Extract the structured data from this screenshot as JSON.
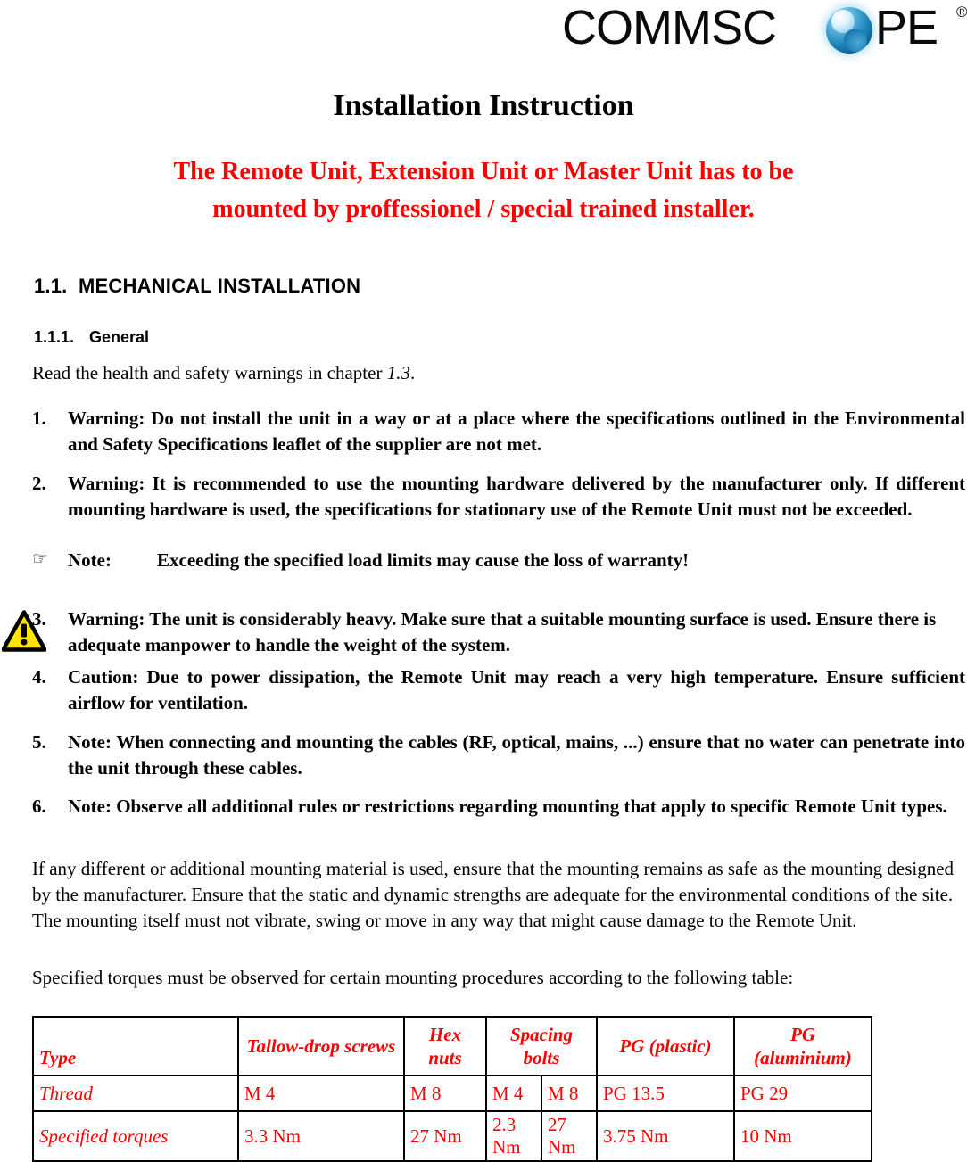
{
  "logo": {
    "text_part1": "COMMSC",
    "text_part2": "PE",
    "registered_mark": "®",
    "sphere_icon": "commscope-sphere-icon",
    "brand_blue": "#1f86bd"
  },
  "title": "Installation Instruction",
  "warning_banner": {
    "line1": "The Remote Unit, Extension Unit or Master Unit has to be",
    "line2": "mounted by proffessionel / special trained installer.",
    "color": "#ff0000"
  },
  "headings": {
    "section_number": "1.1.",
    "section_title": "MECHANICAL INSTALLATION",
    "subsection_number": "1.1.1.",
    "subsection_title": "General"
  },
  "intro": {
    "text_before": "Read the health and safety warnings in chapter ",
    "chapter_ref": "1.3",
    "text_after": "."
  },
  "list": [
    {
      "marker": "1.",
      "text": "Warning: Do not install the unit in a way or at a place where the specifications outlined in the Environmental and Safety Specifications leaflet of the supplier are not met."
    },
    {
      "marker": "2.",
      "text": "Warning: It is recommended to use the mounting hardware delivered by the manufacturer only. If different mounting hardware is used, the specifications for stationary use of the Remote Unit must not be exceeded."
    },
    {
      "marker": "3.",
      "text": " Warning: The unit is considerably heavy. Make sure that a suitable mounting surface is used. Ensure there is adequate manpower to handle the weight of the system."
    },
    {
      "marker": "4.",
      "text": "Caution: Due to power dissipation, the Remote Unit may reach a very high temperature. Ensure sufficient airflow for ventilation."
    },
    {
      "marker": "5.",
      "text": "Note: When connecting and mounting the cables (RF, optical, mains, ...) ensure that no water can penetrate into the unit through these cables."
    },
    {
      "marker": "6.",
      "text": "Note: Observe all additional rules or restrictions regarding mounting that apply to specific Remote Unit types."
    }
  ],
  "note": {
    "hand_icon": "☞",
    "label": "Note:",
    "text": "Exceeding the specified load limits may cause the loss of warranty!"
  },
  "warning_icon": {
    "name": "warning-triangle-icon",
    "fill": "#ffe500",
    "stroke": "#000000",
    "symbol": "!"
  },
  "paragraphs": {
    "p1": "If any different or additional mounting material is used, ensure that the mounting remains as safe as the mounting designed by the manufacturer. Ensure that the static and dynamic strengths are adequate for the environmental conditions of the site. The mounting itself must not vibrate, swing or move in any way that might cause damage to the Remote Unit.",
    "p2": "Specified torques must be observed for certain mounting procedures according to the following table:"
  },
  "table": {
    "headers": {
      "type": "Type",
      "tallow": "Tallow-drop screws",
      "hex": "Hex nuts",
      "spacing": "Spacing bolts",
      "pg_plastic": "PG (plastic)",
      "pg_aluminium": "PG (aluminium)"
    },
    "rows": [
      {
        "label": "Thread",
        "tallow": "M 4",
        "hex": "M 8",
        "spacing1": "M 4",
        "spacing2": "M 8",
        "pg_plastic": "PG 13.5",
        "pg_aluminium": "PG 29"
      },
      {
        "label": "Specified torques",
        "tallow": "3.3 Nm",
        "hex": "27 Nm",
        "spacing1": "2.3 Nm",
        "spacing2": "27 Nm",
        "pg_plastic": "3.75 Nm",
        "pg_aluminium": "10 Nm"
      }
    ]
  }
}
